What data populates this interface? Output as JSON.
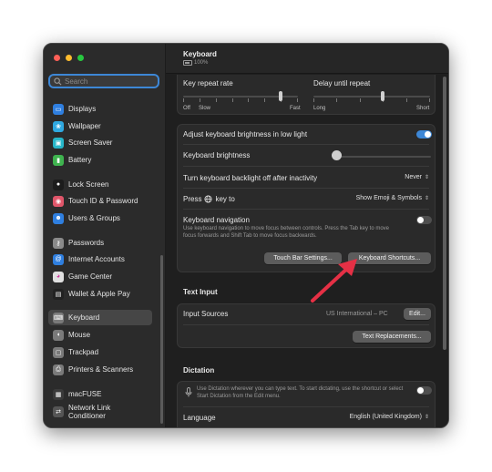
{
  "sidebar": {
    "search_placeholder": "Search",
    "items": [
      {
        "label": "Displays",
        "icon": "displays-icon",
        "color": "#2f7fe0"
      },
      {
        "label": "Wallpaper",
        "icon": "wallpaper-icon",
        "color": "#2fa8e0"
      },
      {
        "label": "Screen Saver",
        "icon": "screen-saver-icon",
        "color": "#27b6c9"
      },
      {
        "label": "Battery",
        "icon": "battery-icon",
        "color": "#3fb34f"
      },
      {
        "label": "Lock Screen",
        "icon": "lock-icon",
        "color": "#1c1c1c"
      },
      {
        "label": "Touch ID & Password",
        "icon": "fingerprint-icon",
        "color": "#e0566a"
      },
      {
        "label": "Users & Groups",
        "icon": "users-icon",
        "color": "#2f7fe0"
      },
      {
        "label": "Passwords",
        "icon": "key-icon",
        "color": "#8a8a8a"
      },
      {
        "label": "Internet Accounts",
        "icon": "at-icon",
        "color": "#2f7fe0"
      },
      {
        "label": "Game Center",
        "icon": "game-center-icon",
        "color": "#e0e0e0"
      },
      {
        "label": "Wallet & Apple Pay",
        "icon": "wallet-icon",
        "color": "#222222"
      },
      {
        "label": "Keyboard",
        "icon": "keyboard-icon",
        "color": "#7a7a7a"
      },
      {
        "label": "Mouse",
        "icon": "mouse-icon",
        "color": "#7a7a7a"
      },
      {
        "label": "Trackpad",
        "icon": "trackpad-icon",
        "color": "#7a7a7a"
      },
      {
        "label": "Printers & Scanners",
        "icon": "printer-icon",
        "color": "#7a7a7a"
      },
      {
        "label": "macFUSE",
        "icon": "macfuse-icon",
        "color": "#3a3a3a"
      },
      {
        "label": "Network Link Conditioner",
        "icon": "network-link-icon",
        "color": "#555555"
      }
    ]
  },
  "header": {
    "title": "Keyboard",
    "battery": "100%"
  },
  "repeat": {
    "key_repeat_rate": "Key repeat rate",
    "off": "Off",
    "slow": "Slow",
    "fast": "Fast",
    "delay_until_repeat": "Delay until repeat",
    "long": "Long",
    "short": "Short",
    "key_repeat_level": 0.86,
    "delay_level": 0.6
  },
  "settings": {
    "adjust_brightness": "Adjust keyboard brightness in low light",
    "adjust_brightness_on": true,
    "keyboard_brightness": "Keyboard brightness",
    "brightness_level": 0.0,
    "backlight_off": "Turn keyboard backlight off after inactivity",
    "backlight_value": "Never",
    "press_key_prefix": "Press",
    "press_key_suffix": "key to",
    "press_key_value": "Show Emoji & Symbols",
    "keyboard_navigation": "Keyboard navigation",
    "keyboard_navigation_on": false,
    "keyboard_navigation_desc": "Use keyboard navigation to move focus between controls. Press the Tab key to move focus forwards and Shift Tab to move focus backwards.",
    "touch_bar_button": "Touch Bar Settings...",
    "shortcuts_button": "Keyboard Shortcuts..."
  },
  "text_input": {
    "section_title": "Text Input",
    "input_sources": "Input Sources",
    "input_sources_value": "US International – PC",
    "edit_button": "Edit...",
    "text_replacements_button": "Text Replacements..."
  },
  "dictation": {
    "section_title": "Dictation",
    "desc": "Use Dictation wherever you can type text. To start dictating, use the shortcut or select Start Dictation from the Edit menu.",
    "enabled": false,
    "language_label": "Language",
    "language_value": "English (United Kingdom)"
  },
  "colors": {
    "accent": "#3d87d6",
    "arrow": "#e53045",
    "toggle_off": "#4f4f4f"
  }
}
